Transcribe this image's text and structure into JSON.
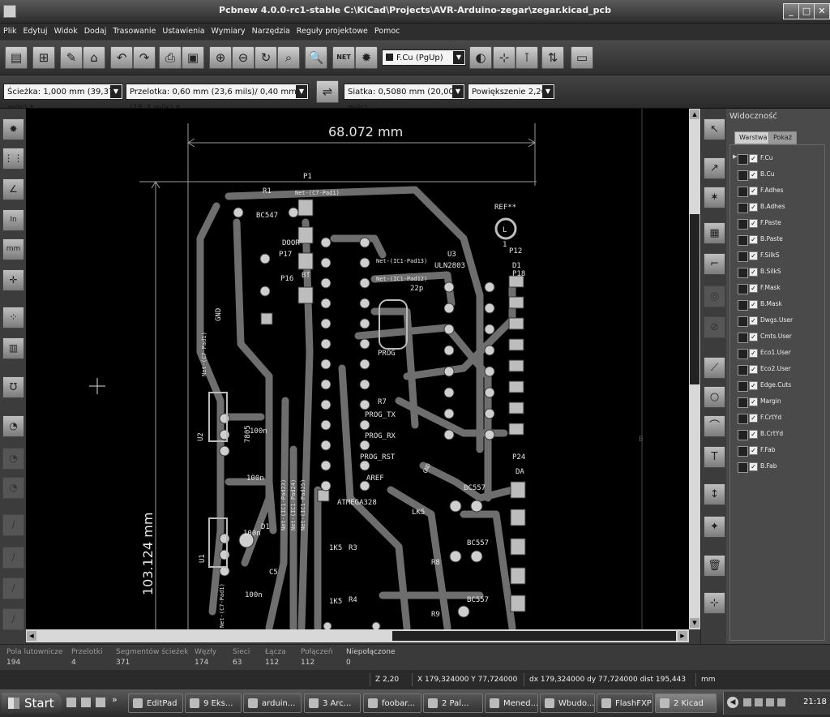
{
  "window": {
    "title": "Pcbnew 4.0.0-rc1-stable C:\\KiCad\\Projects\\AVR-Arduino-zegar\\zegar.kicad_pcb",
    "min": "_",
    "max": "□",
    "close": "✕"
  },
  "menu": [
    "Plik",
    "Edytuj",
    "Widok",
    "Dodaj",
    "Trasowanie",
    "Ustawienia",
    "Wymiary",
    "Narzędzia",
    "Reguły projektowe",
    "Pomoc"
  ],
  "toolbar": {
    "layer_select": "F.Cu (PgUp)",
    "net_label": "NET"
  },
  "toolbar2": {
    "track": "Ścieżka: 1,000 mm (39,37 mils) *",
    "via": "Przelotka: 0,60 mm (23,6 mils)/ 0,40 mm (15,7 mils) *",
    "grid": "Siatka: 0,5080 mm (20,00 mils)",
    "zoom": "Powiększenie 2,20"
  },
  "left_toolbar": {
    "units_in": "In",
    "units_mm": "mm"
  },
  "pcb": {
    "dim_width": "68.072 mm",
    "dim_height": "103.124 mm",
    "labels": [
      {
        "t": "P1"
      },
      {
        "t": "R1"
      },
      {
        "t": "BC547"
      },
      {
        "t": "Net-(C7-Pad1)"
      },
      {
        "t": "REF**"
      },
      {
        "t": "Net-(IC1-Pad13)"
      },
      {
        "t": "Net-(IC1-Pad12)"
      },
      {
        "t": "U3"
      },
      {
        "t": "ULN2803"
      },
      {
        "t": "D1"
      },
      {
        "t": "P18"
      },
      {
        "t": "P12"
      },
      {
        "t": "P17"
      },
      {
        "t": "P16"
      },
      {
        "t": "DOOR"
      },
      {
        "t": "BT"
      },
      {
        "t": "GND"
      },
      {
        "t": "Net-(C7-Pad1)"
      },
      {
        "t": "PROG"
      },
      {
        "t": "PROG_TX"
      },
      {
        "t": "PROG_RX"
      },
      {
        "t": "PROG_RST"
      },
      {
        "t": "AREF"
      },
      {
        "t": "R7"
      },
      {
        "t": "U2"
      },
      {
        "t": "7805"
      },
      {
        "t": "100n"
      },
      {
        "t": "100n"
      },
      {
        "t": "P24"
      },
      {
        "t": "DA"
      },
      {
        "t": "BC557"
      },
      {
        "t": "BC557"
      },
      {
        "t": "BC557"
      },
      {
        "t": "ATMEGA328"
      },
      {
        "t": "LK5"
      },
      {
        "t": "1K5"
      },
      {
        "t": "R3"
      },
      {
        "t": "1K5"
      },
      {
        "t": "R4"
      },
      {
        "t": "R8"
      },
      {
        "t": "R9"
      },
      {
        "t": "U1"
      },
      {
        "t": "100n"
      },
      {
        "t": "100n"
      },
      {
        "t": "Net-(IC1-Pad23)"
      },
      {
        "t": "Net-(IC1-Pad24)"
      },
      {
        "t": "Net-(IC1-Pad25)"
      },
      {
        "t": "Net-(C7-Pad1)"
      },
      {
        "t": "GND"
      },
      {
        "t": "B"
      },
      {
        "t": "1"
      },
      {
        "t": "22p"
      },
      {
        "t": "C5"
      },
      {
        "t": "D1"
      },
      {
        "t": "L"
      }
    ]
  },
  "layers_panel": {
    "header": "Widoczność",
    "tab_layers": "Warstwa",
    "tab_render": "Pokaż",
    "layers": [
      "F.Cu",
      "B.Cu",
      "F.Adhes",
      "B.Adhes",
      "F.Paste",
      "B.Paste",
      "F.SilkS",
      "B.SilkS",
      "F.Mask",
      "B.Mask",
      "Dwgs.User",
      "Cmts.User",
      "Eco1.User",
      "Eco2.User",
      "Edge.Cuts",
      "Margin",
      "F.CrtYd",
      "B.CrtYd",
      "F.Fab",
      "B.Fab"
    ]
  },
  "status": [
    {
      "label": "Pola lutownicze",
      "value": "194"
    },
    {
      "label": "Przelotki",
      "value": "4"
    },
    {
      "label": "Segmentów ścieżek",
      "value": "371"
    },
    {
      "label": "Węzły",
      "value": "174"
    },
    {
      "label": "Sieci",
      "value": "63"
    },
    {
      "label": "Łącza",
      "value": "112"
    },
    {
      "label": "Połączeń",
      "value": "112"
    },
    {
      "label": "Niepołączone",
      "value": "0"
    }
  ],
  "coords": {
    "zoom": "Z 2,20",
    "xy": "X 179,324000  Y 77,724000",
    "dxy": "dx 179,324000  dy 77,724000  dist 195,443",
    "unit": "mm"
  },
  "taskbar": {
    "start": "Start",
    "overflow": "»",
    "tasks": [
      "EditPad",
      "9 Eks...",
      "arduin...",
      "3 Arc...",
      "foobar...",
      "2 Pal...",
      "Mened...",
      "Wbudo...",
      "FlashFXP",
      "2 Kicad"
    ],
    "clock": "21:18"
  }
}
